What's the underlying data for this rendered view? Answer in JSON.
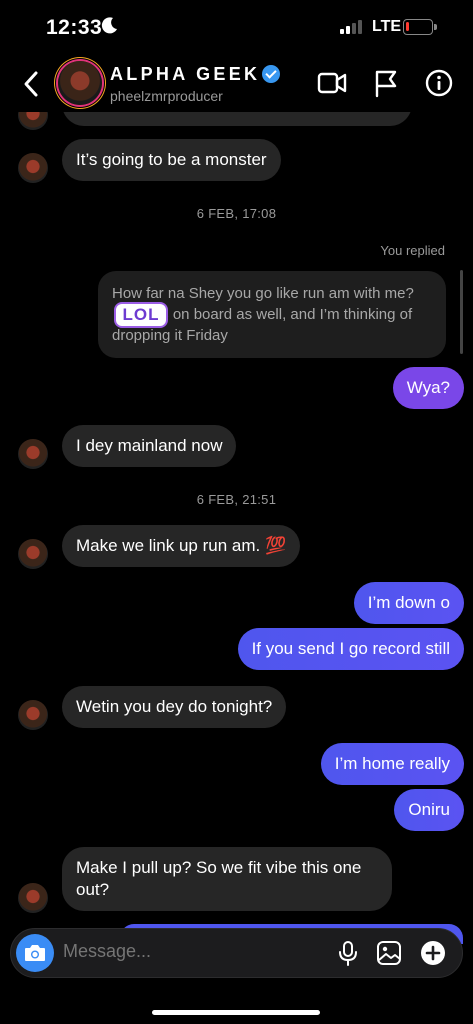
{
  "status": {
    "time": "12:33",
    "network": "LTE",
    "battery_percent": 10
  },
  "header": {
    "name": "ALPHA GEEK",
    "username": "pheelzmrproducer"
  },
  "chat": {
    "partial_top": "",
    "msg1": "It’s going to be a monster",
    "stamp1": "6 FEB, 17:08",
    "replied": "You replied",
    "quote": "How far na Shey you go like run am with me?            is on board as well, and I’m thinking of dropping it Friday",
    "sticker": "LOL",
    "reply": "Wya?",
    "msg2": "I dey mainland now",
    "stamp2": "6 FEB, 21:51",
    "msg3": "Make we link up run am. 💯",
    "out1": "I’m down o",
    "out2": "If you send I go record still",
    "msg4": "Wetin you dey do tonight?",
    "out3": "I’m home really",
    "out4": "Oniru",
    "msg5_line1": "Make I pull up? So we fit vibe this one",
    "msg5_line2": "out?"
  },
  "composer": {
    "placeholder": "Message..."
  },
  "colors": {
    "outgoing": "#5b53f2",
    "reply_bubble": "#7a47e8",
    "incoming": "#262626",
    "camera": "#3a8cf5"
  }
}
